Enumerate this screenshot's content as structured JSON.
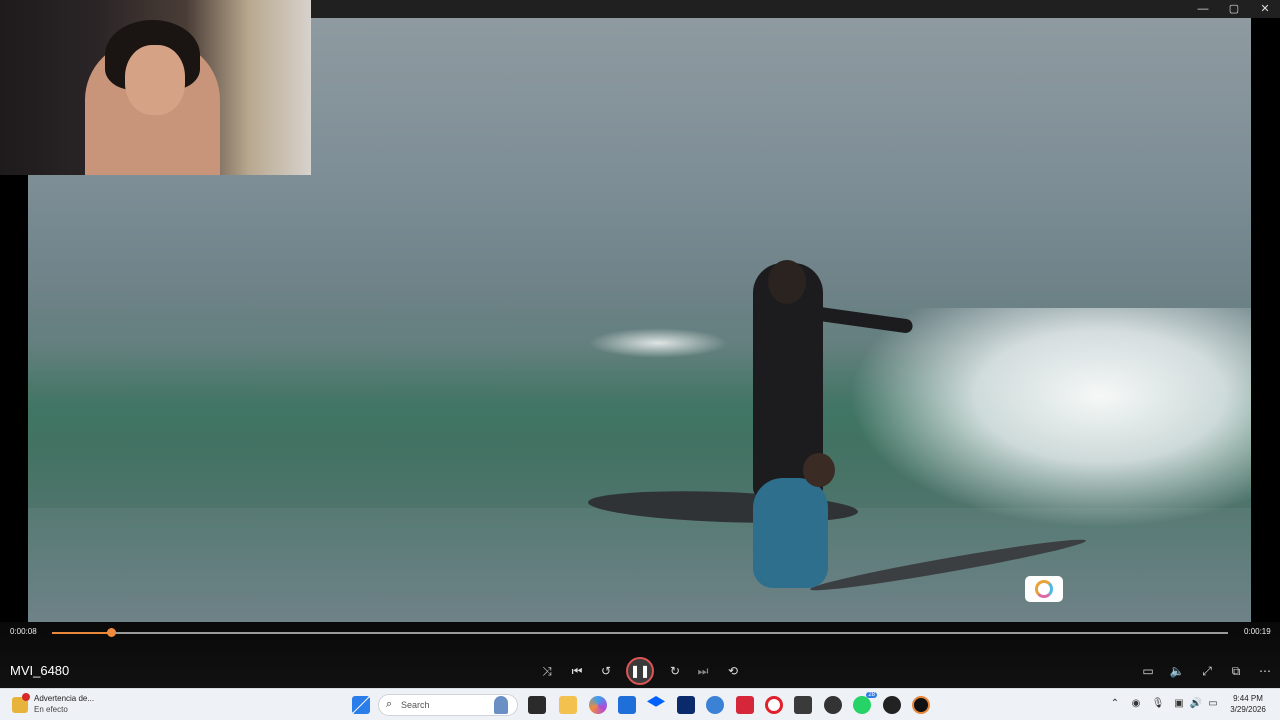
{
  "window": {
    "minimize_glyph": "—",
    "maximize_glyph": "▢",
    "close_glyph": "✕"
  },
  "player": {
    "title": "MVI_6480",
    "time_current": "0:00:08",
    "time_total": "0:00:19",
    "progress_fraction": 0.05,
    "accent_color": "#e8863a",
    "controls": {
      "shuffle": "shuffle-icon",
      "previous": "skip-back-icon",
      "rewind": "rewind-10-icon",
      "play_pause": "pause-icon",
      "forward": "forward-30-icon",
      "next": "skip-next-icon",
      "repeat": "repeat-off-icon",
      "subtitles": "subtitles-icon",
      "volume": "volume-icon",
      "fullscreen": "fullscreen-icon",
      "miniplayer": "miniplayer-icon",
      "more": "more-icon"
    }
  },
  "taskbar": {
    "weather_line1": "Advertencia de...",
    "weather_line2": "En efecto",
    "search_placeholder": "Search",
    "whatsapp_badge": "28",
    "time": "9:44 PM",
    "date": "3/29/2026"
  }
}
